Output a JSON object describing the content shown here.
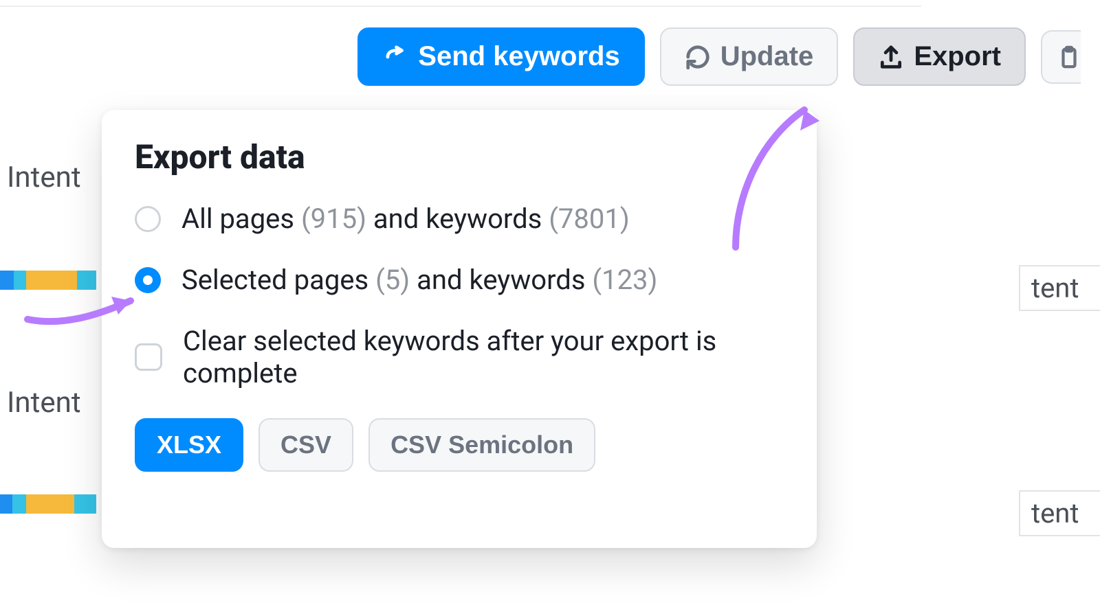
{
  "toolbar": {
    "send_keywords_label": "Send keywords",
    "update_label": "Update",
    "export_label": "Export"
  },
  "background": {
    "intent_label": "Intent",
    "right_partial_1": "tent",
    "right_partial_2": "tent"
  },
  "popover": {
    "title": "Export data",
    "option_all": {
      "part1": "All pages ",
      "pages_count": "(915)",
      "part2": " and keywords ",
      "keywords_count": "(7801)",
      "selected": false
    },
    "option_selected": {
      "part1": "Selected pages ",
      "pages_count": "(5)",
      "part2": " and keywords ",
      "keywords_count": "(123)",
      "selected": true
    },
    "checkbox_label": "Clear selected keywords after your export is complete",
    "formats": {
      "xlsx": "XLSX",
      "csv": "CSV",
      "csv_semi": "CSV Semicolon"
    }
  },
  "colors": {
    "primary": "#008cff",
    "arrow": "#b77bff"
  }
}
